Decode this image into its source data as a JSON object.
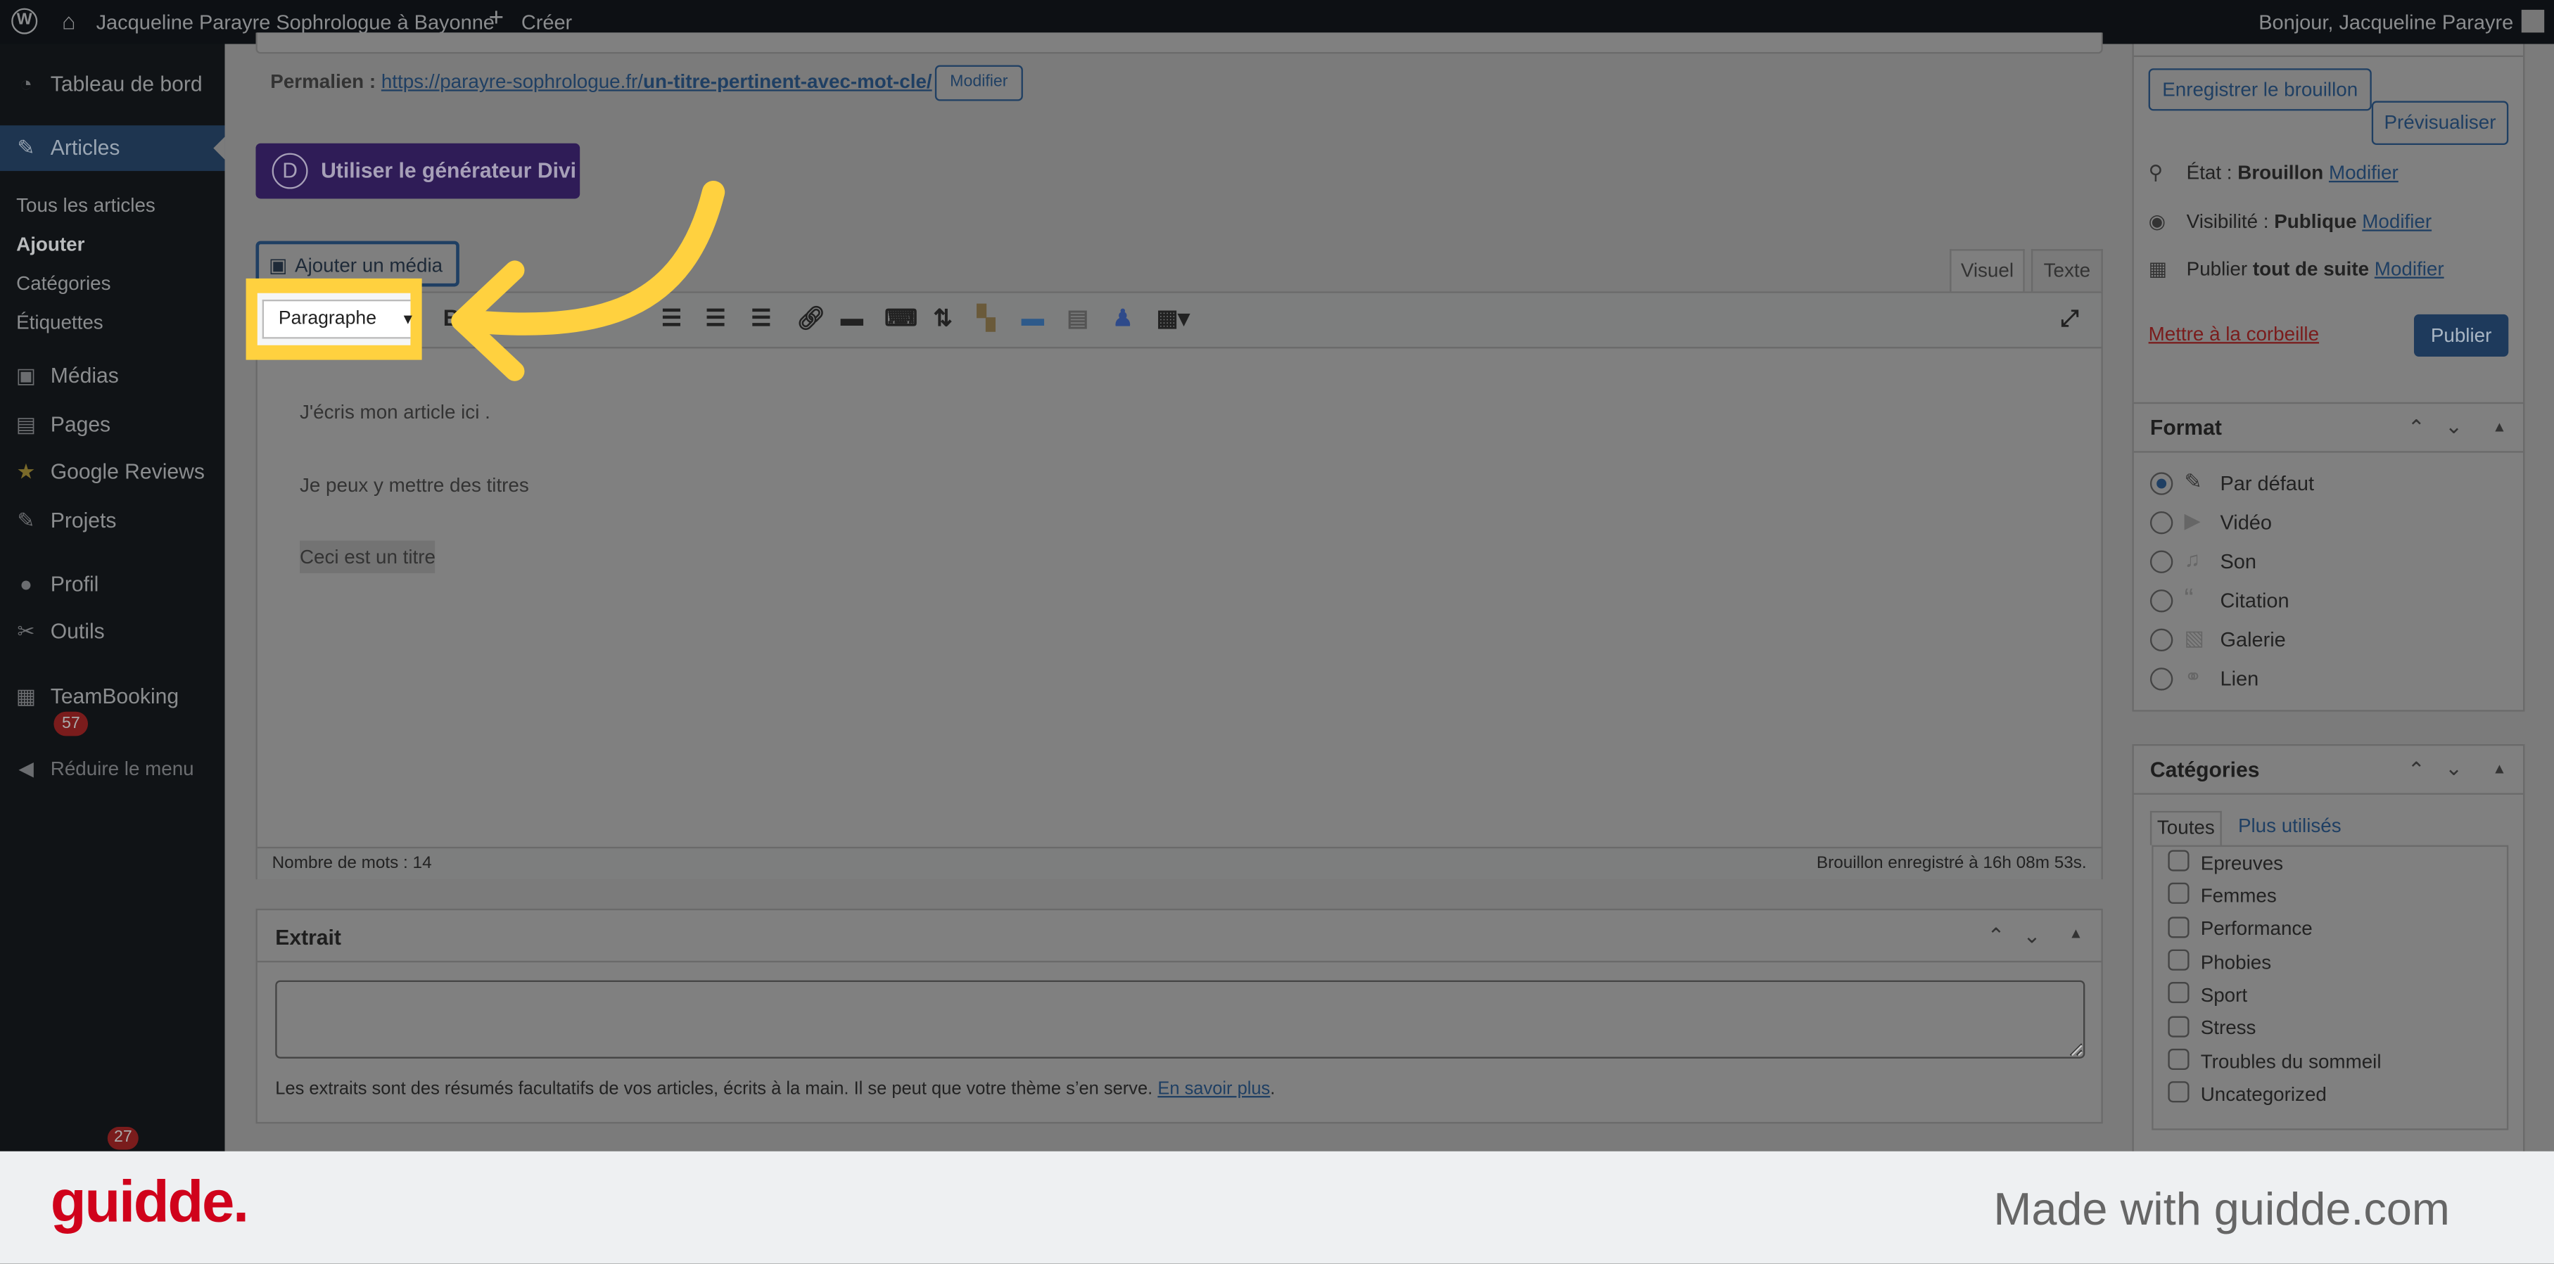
{
  "adminbar": {
    "site": "Jacqueline Parayre Sophrologue à Bayonne",
    "create": "Créer",
    "greeting": "Bonjour, Jacqueline Parayre"
  },
  "sidebar": {
    "items": [
      {
        "label": "Tableau de bord",
        "icon": "dashboard-icon"
      },
      {
        "label": "Articles",
        "icon": "pin-icon"
      },
      {
        "label": "Médias",
        "icon": "media-icon"
      },
      {
        "label": "Pages",
        "icon": "pages-icon"
      },
      {
        "label": "Google Reviews",
        "icon": "star-icon"
      },
      {
        "label": "Projets",
        "icon": "pin-icon"
      },
      {
        "label": "Profil",
        "icon": "user-icon"
      },
      {
        "label": "Outils",
        "icon": "wrench-icon"
      },
      {
        "label": "TeamBooking",
        "icon": "calendar-icon",
        "badge": "57"
      },
      {
        "label": "Réduire le menu",
        "icon": "collapse-icon"
      }
    ],
    "subitems": [
      "Tous les articles",
      "Ajouter",
      "Catégories",
      "Étiquettes"
    ],
    "bottom_badge": "27"
  },
  "permalink": {
    "label": "Permalien :",
    "url_base": "https://parayre-sophrologue.fr/",
    "url_slug": "un-titre-pertinent-avec-mot-cle/",
    "edit": "Modifier"
  },
  "divi_button": "Utiliser le générateur Divi",
  "add_media": "Ajouter un média",
  "editor": {
    "tabs": [
      "Visuel",
      "Texte"
    ],
    "format_select": "Paragraphe",
    "paragraphs": [
      "J'écris mon article ici .",
      "Je peux y mettre des titres",
      "Ceci est un titre"
    ],
    "word_count": "Nombre de mots : 14",
    "saved": "Brouillon enregistré à 16h 08m 53s."
  },
  "excerpt": {
    "title": "Extrait",
    "value": "",
    "help": "Les extraits sont des résumés facultatifs de vos articles, écrits à la main. Il se peut que votre thème s’en serve.",
    "link": "En savoir plus",
    "period": "."
  },
  "publish": {
    "save_draft": "Enregistrer le brouillon",
    "preview": "Prévisualiser",
    "status_label": "État :",
    "status": "Brouillon",
    "visibility_label": "Visibilité :",
    "visibility": "Publique",
    "publish_label": "Publier",
    "publish_when": "tout de suite",
    "edit": "Modifier",
    "trash": "Mettre à la corbeille",
    "publish_btn": "Publier"
  },
  "format": {
    "title": "Format",
    "selected": "Par défaut",
    "options": [
      "Par défaut",
      "Vidéo",
      "Son",
      "Citation",
      "Galerie",
      "Lien"
    ]
  },
  "categories": {
    "title": "Catégories",
    "tabs": [
      "Toutes",
      "Plus utilisés"
    ],
    "items": [
      "Epreuves",
      "Femmes",
      "Performance",
      "Phobies",
      "Sport",
      "Stress",
      "Troubles du sommeil",
      "Uncategorized"
    ]
  },
  "footer": {
    "logo": "guidde.",
    "tagline": "Made with guidde.com"
  },
  "colors": {
    "highlight": "#ffd13f",
    "brand": "#d0021b",
    "divi": "#2f1c57"
  }
}
